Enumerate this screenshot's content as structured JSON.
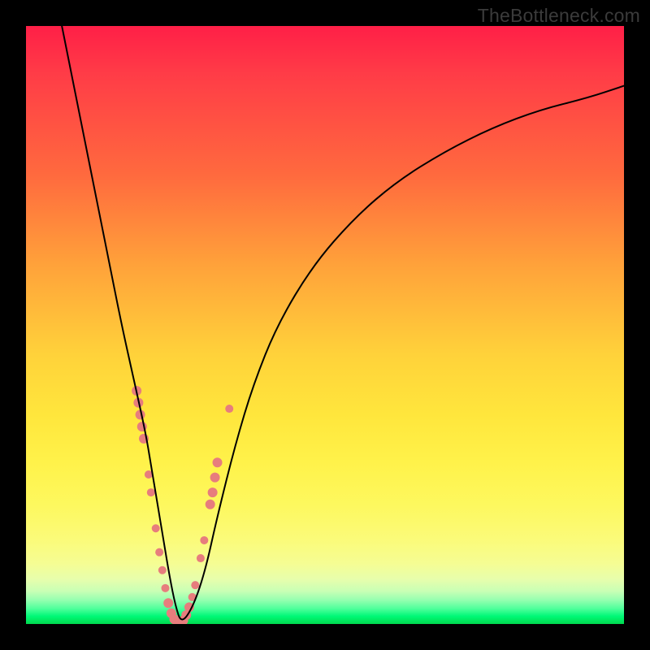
{
  "watermark": "TheBottleneck.com",
  "chart_data": {
    "type": "line",
    "title": "",
    "xlabel": "",
    "ylabel": "",
    "xlim": [
      0,
      100
    ],
    "ylim": [
      0,
      100
    ],
    "series": [
      {
        "name": "bottleneck-curve",
        "x": [
          6,
          8,
          10,
          12,
          14,
          16,
          18,
          20,
          21,
          22,
          23,
          24,
          25,
          26,
          28,
          30,
          32,
          35,
          38,
          42,
          48,
          55,
          62,
          70,
          78,
          86,
          94,
          100
        ],
        "values": [
          100,
          90,
          80,
          70,
          60,
          50,
          41,
          32,
          26,
          20,
          14,
          8,
          3,
          0,
          3,
          9,
          18,
          30,
          40,
          50,
          60,
          68,
          74,
          79,
          83,
          86,
          88,
          90
        ]
      }
    ],
    "markers": {
      "name": "highlight-dots",
      "color": "#e77d7d",
      "points": [
        {
          "x": 18.5,
          "y": 39,
          "r": 6
        },
        {
          "x": 18.8,
          "y": 37,
          "r": 6
        },
        {
          "x": 19.1,
          "y": 35,
          "r": 6
        },
        {
          "x": 19.4,
          "y": 33,
          "r": 6
        },
        {
          "x": 19.7,
          "y": 31,
          "r": 6
        },
        {
          "x": 20.5,
          "y": 25,
          "r": 5
        },
        {
          "x": 20.9,
          "y": 22,
          "r": 5
        },
        {
          "x": 21.7,
          "y": 16,
          "r": 5
        },
        {
          "x": 22.3,
          "y": 12,
          "r": 5
        },
        {
          "x": 22.8,
          "y": 9,
          "r": 5
        },
        {
          "x": 23.3,
          "y": 6,
          "r": 5
        },
        {
          "x": 23.8,
          "y": 3.5,
          "r": 6
        },
        {
          "x": 24.3,
          "y": 1.8,
          "r": 6
        },
        {
          "x": 24.8,
          "y": 0.8,
          "r": 6
        },
        {
          "x": 25.3,
          "y": 0.3,
          "r": 6
        },
        {
          "x": 25.8,
          "y": 0.2,
          "r": 6
        },
        {
          "x": 26.3,
          "y": 0.6,
          "r": 6
        },
        {
          "x": 26.8,
          "y": 1.5,
          "r": 6
        },
        {
          "x": 27.3,
          "y": 2.8,
          "r": 6
        },
        {
          "x": 27.8,
          "y": 4.5,
          "r": 5
        },
        {
          "x": 28.3,
          "y": 6.5,
          "r": 5
        },
        {
          "x": 29.2,
          "y": 11,
          "r": 5
        },
        {
          "x": 29.8,
          "y": 14,
          "r": 5
        },
        {
          "x": 30.8,
          "y": 20,
          "r": 6
        },
        {
          "x": 31.2,
          "y": 22,
          "r": 6
        },
        {
          "x": 31.6,
          "y": 24.5,
          "r": 6
        },
        {
          "x": 32.0,
          "y": 27,
          "r": 6
        },
        {
          "x": 34.0,
          "y": 36,
          "r": 5
        }
      ]
    }
  }
}
